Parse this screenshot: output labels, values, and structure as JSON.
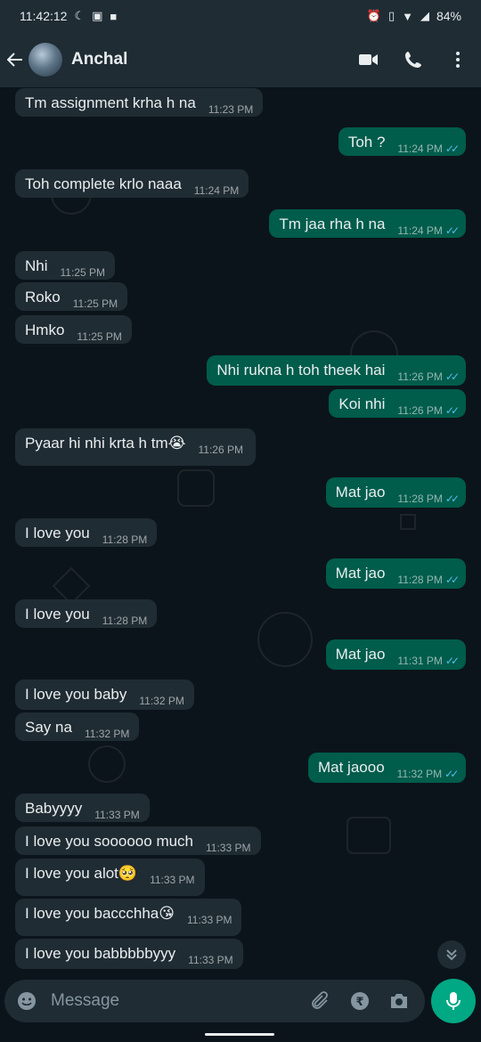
{
  "status": {
    "time": "11:42:12",
    "battery": "84%"
  },
  "header": {
    "contact_name": "Anchal"
  },
  "messages": [
    {
      "dir": "in",
      "text": "Tm assignment krha h na",
      "time": "11:23 PM"
    },
    {
      "dir": "out",
      "text": "Toh ?",
      "time": "11:24 PM"
    },
    {
      "dir": "in",
      "text": "Toh complete krlo naaa",
      "time": "11:24 PM"
    },
    {
      "dir": "out",
      "text": "Tm jaa rha h na",
      "time": "11:24 PM"
    },
    {
      "dir": "in",
      "text": "Nhi",
      "time": "11:25 PM"
    },
    {
      "dir": "in",
      "text": "Roko",
      "time": "11:25 PM"
    },
    {
      "dir": "in",
      "text": "Hmko",
      "time": "11:25 PM"
    },
    {
      "dir": "out",
      "text": "Nhi rukna h toh theek hai",
      "time": "11:26 PM"
    },
    {
      "dir": "out",
      "text": "Koi nhi",
      "time": "11:26 PM"
    },
    {
      "dir": "in",
      "text": "Pyaar hi nhi krta h tm",
      "emoji": "😭",
      "time": "11:26 PM"
    },
    {
      "dir": "out",
      "text": "Mat jao",
      "time": "11:28 PM"
    },
    {
      "dir": "in",
      "text": "I love you",
      "time": "11:28 PM"
    },
    {
      "dir": "out",
      "text": "Mat jao",
      "time": "11:28 PM"
    },
    {
      "dir": "in",
      "text": "I love you",
      "time": "11:28 PM"
    },
    {
      "dir": "out",
      "text": "Mat jao",
      "time": "11:31 PM"
    },
    {
      "dir": "in",
      "text": "I love you baby",
      "time": "11:32 PM"
    },
    {
      "dir": "in",
      "text": "Say na",
      "time": "11:32 PM"
    },
    {
      "dir": "out",
      "text": "Mat jaooo",
      "time": "11:32 PM"
    },
    {
      "dir": "in",
      "text": "Babyyyy",
      "time": "11:33 PM"
    },
    {
      "dir": "in",
      "text": "I love you soooooo much",
      "time": "11:33 PM"
    },
    {
      "dir": "in",
      "text": "I love you alot",
      "emoji": "🥺",
      "time": "11:33 PM"
    },
    {
      "dir": "in",
      "text": "I love you baccchha",
      "emoji": "😘",
      "time": "11:33 PM"
    },
    {
      "dir": "in",
      "text": "I love you babbbbbyyy",
      "time": "11:33 PM"
    }
  ],
  "composer": {
    "placeholder": "Message"
  },
  "colors": {
    "incoming": "#202c33",
    "outgoing": "#005c4b",
    "accent": "#00a884",
    "read_ticks": "#53bdeb"
  },
  "icons": {
    "back": "arrow-left-icon",
    "video": "video-call-icon",
    "call": "phone-icon",
    "menu": "more-vertical-icon",
    "emoji": "emoji-icon",
    "attach": "paperclip-icon",
    "payment": "rupee-icon",
    "camera": "camera-icon",
    "mic": "mic-icon",
    "scroll": "double-chevron-down-icon"
  }
}
